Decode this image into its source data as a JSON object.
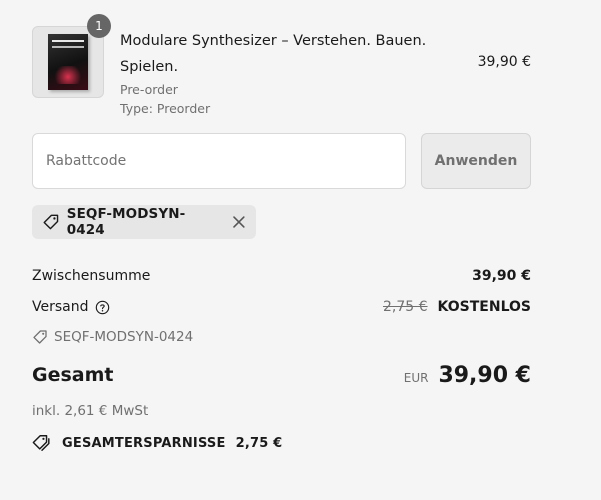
{
  "product": {
    "quantity_badge": "1",
    "title": "Modulare Synthesizer – Verstehen. Bauen. Spielen.",
    "variant": "Pre-order",
    "type_line": "Type: Preorder",
    "price": "39,90 €",
    "thumbnail_icon": "book-cover-image"
  },
  "discount": {
    "placeholder": "Rabattcode",
    "value": "",
    "apply_label": "Anwenden",
    "applied_code": "SEQF-MODSYN-0424"
  },
  "summary": {
    "subtotal_label": "Zwischensumme",
    "subtotal_value": "39,90 €",
    "shipping_label": "Versand",
    "shipping_original": "2,75 €",
    "shipping_value": "KOSTENLOS",
    "discount_code_label": "SEQF-MODSYN-0424",
    "total_label": "Gesamt",
    "currency": "EUR",
    "total_value": "39,90 €",
    "tax_note": "inkl. 2,61 € MwSt",
    "savings_label": "GESAMTERSPARNISSE",
    "savings_value": "2,75 €"
  },
  "colors": {
    "background": "#f5f5f5",
    "badge": "#666666",
    "muted_text": "#707070",
    "chip": "#e6e6e6"
  }
}
